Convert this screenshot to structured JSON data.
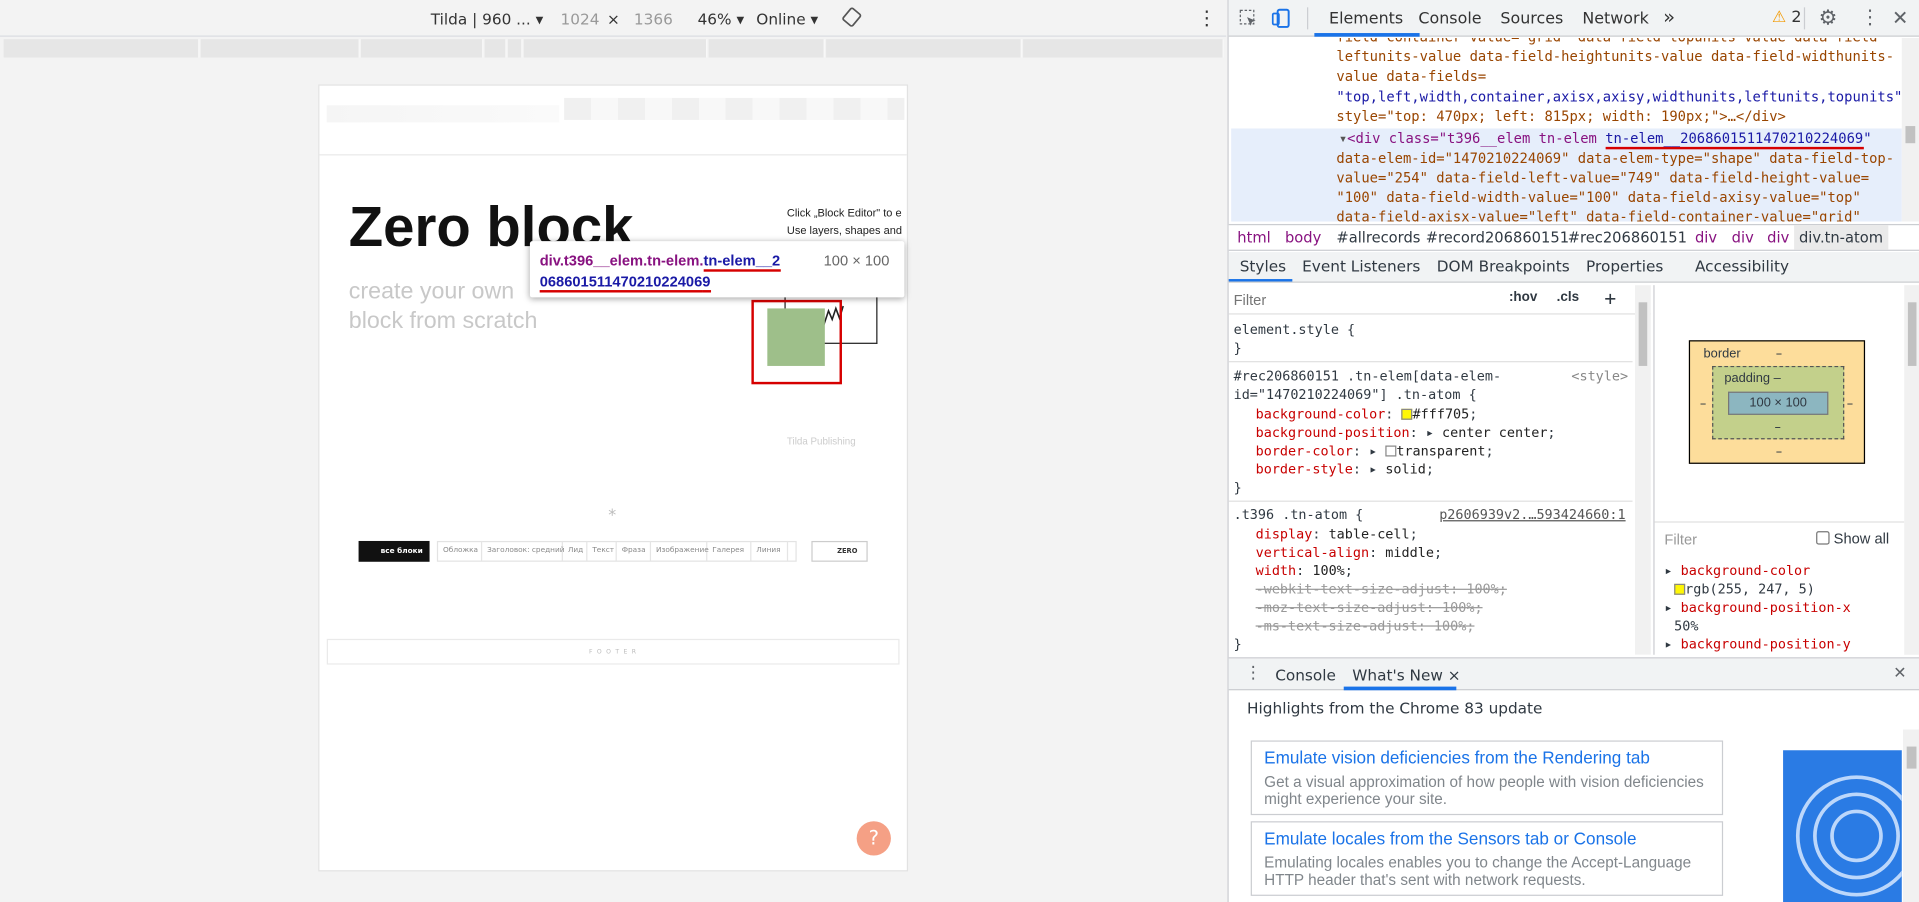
{
  "device_toolbar": {
    "device_name": "Tilda | 960 ...",
    "width": "1024",
    "times": "×",
    "height": "1366",
    "zoom": "46%",
    "throttle": "Online"
  },
  "page": {
    "title": "Zero block",
    "subtitle_line1": "create your own",
    "subtitle_line2": "block from scratch",
    "hint_line1": "Click „Block Editor\" to e",
    "hint_line2": "Use layers, shapes and",
    "publishing": "Tilda Publishing",
    "star": "*",
    "all_blocks_button": "все блоки",
    "template_buttons": [
      "Обложка",
      "Заголовок: средний",
      "Лид",
      "Текст",
      "Фраза",
      "Изображение",
      "Галерея",
      "Линия"
    ],
    "zero_button": "ZERO",
    "footer": "F O O T E R",
    "help": "?"
  },
  "tooltip": {
    "selector_part1": "div.t396__elem.tn-elem.",
    "selector_part2": "tn-elem__2",
    "selector_part3": "06860151147021022406",
    "selector_part4": "9",
    "size": "100 × 100"
  },
  "devtools": {
    "tabs": [
      "Elements",
      "Console",
      "Sources",
      "Network"
    ],
    "more": "»",
    "warnings": "2",
    "elements_lines": [
      "field-container-value=\"grid\" data-field-topunits-value data-field-",
      "leftunits-value data-field-heightunits-value data-field-widthunits-",
      "value data-fields=",
      "\"top,left,width,container,axisx,axisy,widthunits,leftunits,topunits\"",
      "style=\"top: 470px; left: 815px; width: 190px;\">…</div>"
    ],
    "selected_node": {
      "open": "<div class=\"t396__elem tn-elem ",
      "underlined": "tn-elem__2068601511470210224069",
      "close": "\"",
      "line2": "data-elem-id=\"1470210224069\" data-elem-type=\"shape\" data-field-top-",
      "line3": "value=\"254\" data-field-left-value=\"749\" data-field-height-value=",
      "line4": "\"100\" data-field-width-value=\"100\" data-field-axisy-value=\"top\"",
      "line5": "data-field-axisx-value=\"left\" data-field-container-value=\"grid\""
    },
    "breadcrumbs": [
      "html",
      "body",
      "#allrecords",
      "#record206860151",
      "#rec206860151",
      "div",
      "div",
      "div",
      "div.tn-atom"
    ],
    "subtabs": [
      "Styles",
      "Event Listeners",
      "DOM Breakpoints",
      "Properties",
      "Accessibility"
    ],
    "filter_placeholder": "Filter",
    "hov": ":hov",
    "cls": ".cls",
    "plus": "+",
    "styles": {
      "element_style": "element.style {",
      "close_brace": "}",
      "rule1_selector_a": "#rec206860151 .tn-elem[data-elem-",
      "rule1_selector_b": "id=\"1470210224069\"] .tn-atom {",
      "rule1_source": "<style>",
      "rule1_props": [
        {
          "name": "background-color",
          "value": "#fff705"
        },
        {
          "name": "background-position",
          "value": "center center"
        },
        {
          "name": "border-color",
          "value": "transparent"
        },
        {
          "name": "border-style",
          "value": "solid"
        }
      ],
      "rule2_selector": ".t396 .tn-atom {",
      "rule2_source": "p2606939v2.…593424660:1",
      "rule2_props": [
        {
          "name": "display",
          "value": "table-cell"
        },
        {
          "name": "vertical-align",
          "value": "middle"
        },
        {
          "name": "width",
          "value": "100%"
        }
      ],
      "rule2_struck": [
        "-webkit-text-size-adjust: 100%;",
        "-moz-text-size-adjust: 100%;",
        "-ms-text-size-adjust: 100%;"
      ]
    },
    "boxmodel": {
      "border": "border",
      "padding": "padding",
      "dash": "–",
      "content": "100 × 100"
    },
    "computed": {
      "filter": "Filter",
      "show_all": "Show all",
      "items": [
        {
          "name": "background-color",
          "value": "rgb(255, 247, 5)"
        },
        {
          "name": "background-position-x",
          "value": "50%"
        },
        {
          "name": "background-position-y",
          "value": ""
        }
      ]
    },
    "drawer": {
      "tabs": [
        "Console",
        "What's New"
      ],
      "close_tab": "×",
      "close": "✕",
      "headline": "Highlights from the Chrome 83 update",
      "cards": [
        {
          "title": "Emulate vision deficiencies from the Rendering tab",
          "desc": "Get a visual approximation of how people with vision deficiencies might experience your site."
        },
        {
          "title": "Emulate locales from the Sensors tab or Console",
          "desc": "Emulating locales enables you to change the Accept-Language HTTP header that's sent with network requests."
        }
      ]
    }
  },
  "colors": {
    "accent": "#1a73e8",
    "swatch": "#fff705",
    "warning": "#f29900",
    "highlight_red": "#d60000"
  }
}
